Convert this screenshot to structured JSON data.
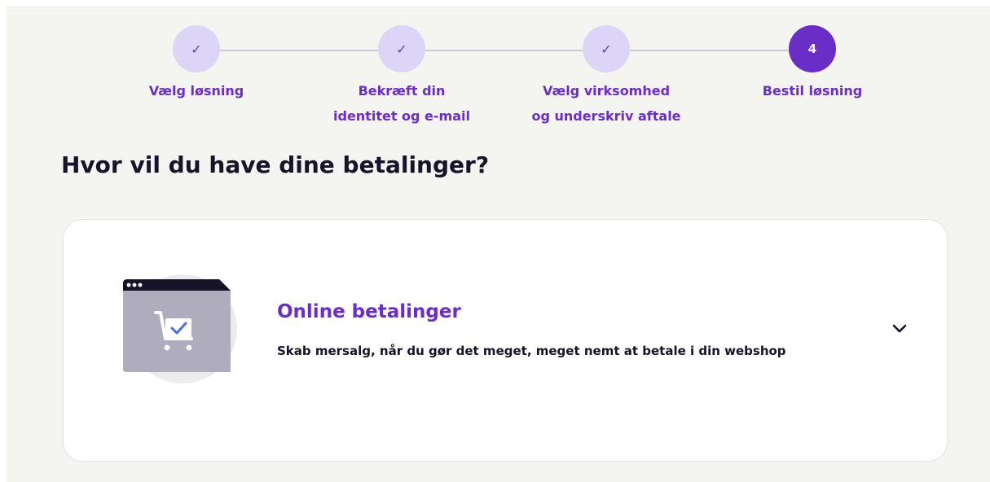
{
  "stepper": {
    "steps": [
      {
        "label": "Vælg løsning",
        "state": "done",
        "icon": "check-icon"
      },
      {
        "label": "Bekræft din\nidentitet og e-mail",
        "state": "done",
        "icon": "check-icon"
      },
      {
        "label": "Vælg virksomhed\nog underskriv aftale",
        "state": "done",
        "icon": "check-icon"
      },
      {
        "label": "Bestil løsning",
        "state": "active",
        "number": "4"
      }
    ],
    "check_glyph": "✓"
  },
  "heading": "Hvor vil du have dine betalinger?",
  "card": {
    "title": "Online betalinger",
    "description": "Skab mersalg, når du gør det meget, meget nemt at betale i din webshop",
    "illustration_icon": "webshop-cart-icon",
    "expand_icon": "chevron-down-icon"
  },
  "colors": {
    "accent": "#6b2dc8",
    "step_done_bg": "#ddd5f8",
    "page_bg": "#f4f4f1",
    "text_dark": "#16132a"
  }
}
